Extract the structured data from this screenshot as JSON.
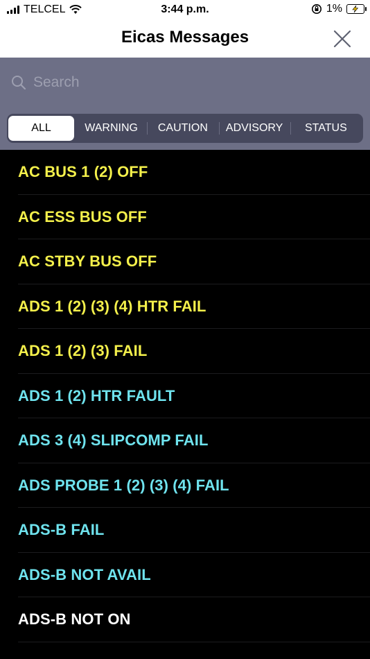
{
  "status_bar": {
    "carrier": "TELCEL",
    "time": "3:44 p.m.",
    "battery": "1%"
  },
  "nav": {
    "title": "Eicas Messages",
    "close_icon": "close-icon"
  },
  "search": {
    "placeholder": "Search",
    "value": ""
  },
  "tabs": [
    {
      "label": "ALL",
      "selected": true
    },
    {
      "label": "WARNING",
      "selected": false
    },
    {
      "label": "CAUTION",
      "selected": false
    },
    {
      "label": "ADVISORY",
      "selected": false
    },
    {
      "label": "STATUS",
      "selected": false
    }
  ],
  "colors": {
    "caution": "#f4f04b",
    "advisory": "#6fe3ee",
    "status": "#ffffff",
    "filter_bg": "#6d6f86"
  },
  "messages": [
    {
      "text": "AC BUS 1 (2) OFF",
      "level": "caution"
    },
    {
      "text": "AC ESS BUS OFF",
      "level": "caution"
    },
    {
      "text": "AC STBY BUS OFF",
      "level": "caution"
    },
    {
      "text": "ADS 1 (2) (3) (4) HTR FAIL",
      "level": "caution"
    },
    {
      "text": "ADS 1 (2) (3) FAIL",
      "level": "caution"
    },
    {
      "text": "ADS 1 (2) HTR FAULT",
      "level": "advisory"
    },
    {
      "text": "ADS 3 (4) SLIPCOMP FAIL",
      "level": "advisory"
    },
    {
      "text": "ADS PROBE 1 (2) (3) (4) FAIL",
      "level": "advisory"
    },
    {
      "text": "ADS-B FAIL",
      "level": "advisory"
    },
    {
      "text": "ADS-B NOT AVAIL",
      "level": "advisory"
    },
    {
      "text": "ADS-B NOT ON",
      "level": "status"
    }
  ]
}
